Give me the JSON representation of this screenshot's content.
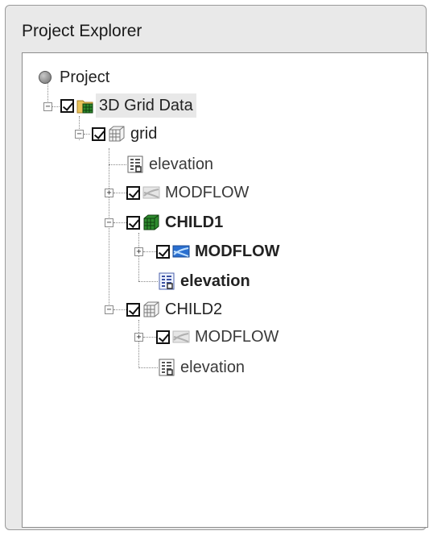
{
  "window": {
    "title": "Project Explorer"
  },
  "tree": {
    "root": {
      "label": "Project"
    },
    "grid_data": {
      "label": "3D Grid Data"
    },
    "grid": {
      "label": "grid"
    },
    "grid_elevation": {
      "label": "elevation"
    },
    "grid_modflow": {
      "label": "MODFLOW"
    },
    "child1": {
      "label": "CHILD1"
    },
    "child1_modflow": {
      "label": "MODFLOW"
    },
    "child1_elevation": {
      "label": "elevation"
    },
    "child2": {
      "label": "CHILD2"
    },
    "child2_modflow": {
      "label": "MODFLOW"
    },
    "child2_elevation": {
      "label": "elevation"
    }
  },
  "icons": {
    "folder": "folder-grid-icon",
    "grid": "grid-icon",
    "grid_active": "grid-active-icon",
    "dataset": "dataset-icon",
    "modflow": "modflow-icon"
  },
  "colors": {
    "accent_green": "#2e8b2e",
    "accent_blue": "#2a6fd0"
  }
}
